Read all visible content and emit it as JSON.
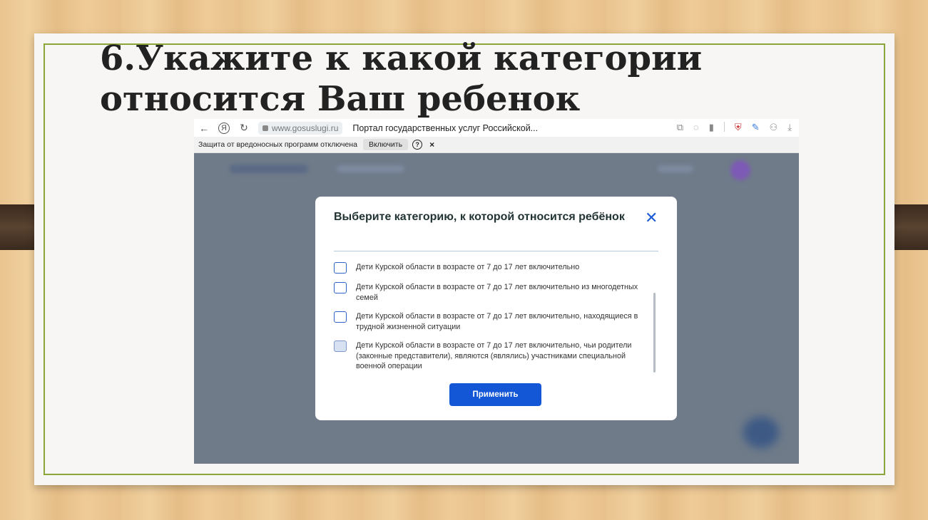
{
  "slide": {
    "title_line1": "6.Укажите к какой категории",
    "title_line2": "относится Ваш ребенок"
  },
  "browser": {
    "back_icon": "←",
    "yandex_icon": "Я",
    "reload_icon": "↻",
    "url": "www.gosuslugi.ru",
    "page_title": "Портал государственных услуг Российской...",
    "icons": [
      "extensions-icon",
      "translate-icon",
      "bookmark-icon",
      "shield-icon",
      "feather-icon",
      "profile-icon",
      "download-icon"
    ]
  },
  "warnbar": {
    "text": "Защита от вредоносных программ отключена",
    "enable_label": "Включить",
    "help_label": "?",
    "close_label": "×"
  },
  "modal": {
    "title": "Выберите категорию, к которой относится ребёнок",
    "close_label": "✕",
    "options": [
      {
        "label": "Дети Курской области в возрасте от 7 до 17 лет включительно",
        "checked": false
      },
      {
        "label": "Дети Курской области в возрасте от 7 до 17 лет включительно из многодетных семей",
        "checked": false
      },
      {
        "label": "Дети Курской области в возрасте от 7 до 17 лет включительно, находящиеся в трудной жизненной ситуации",
        "checked": false
      },
      {
        "label": "Дети Курской области в возрасте от 7 до 17 лет включительно, чьи родители (законные представители), являются (являлись) участниками специальной военной операции",
        "checked": false
      }
    ],
    "apply_label": "Применить"
  },
  "colors": {
    "primary": "#1357d6",
    "overlay": "#6f7b89",
    "slide_border": "#8aa63b"
  }
}
